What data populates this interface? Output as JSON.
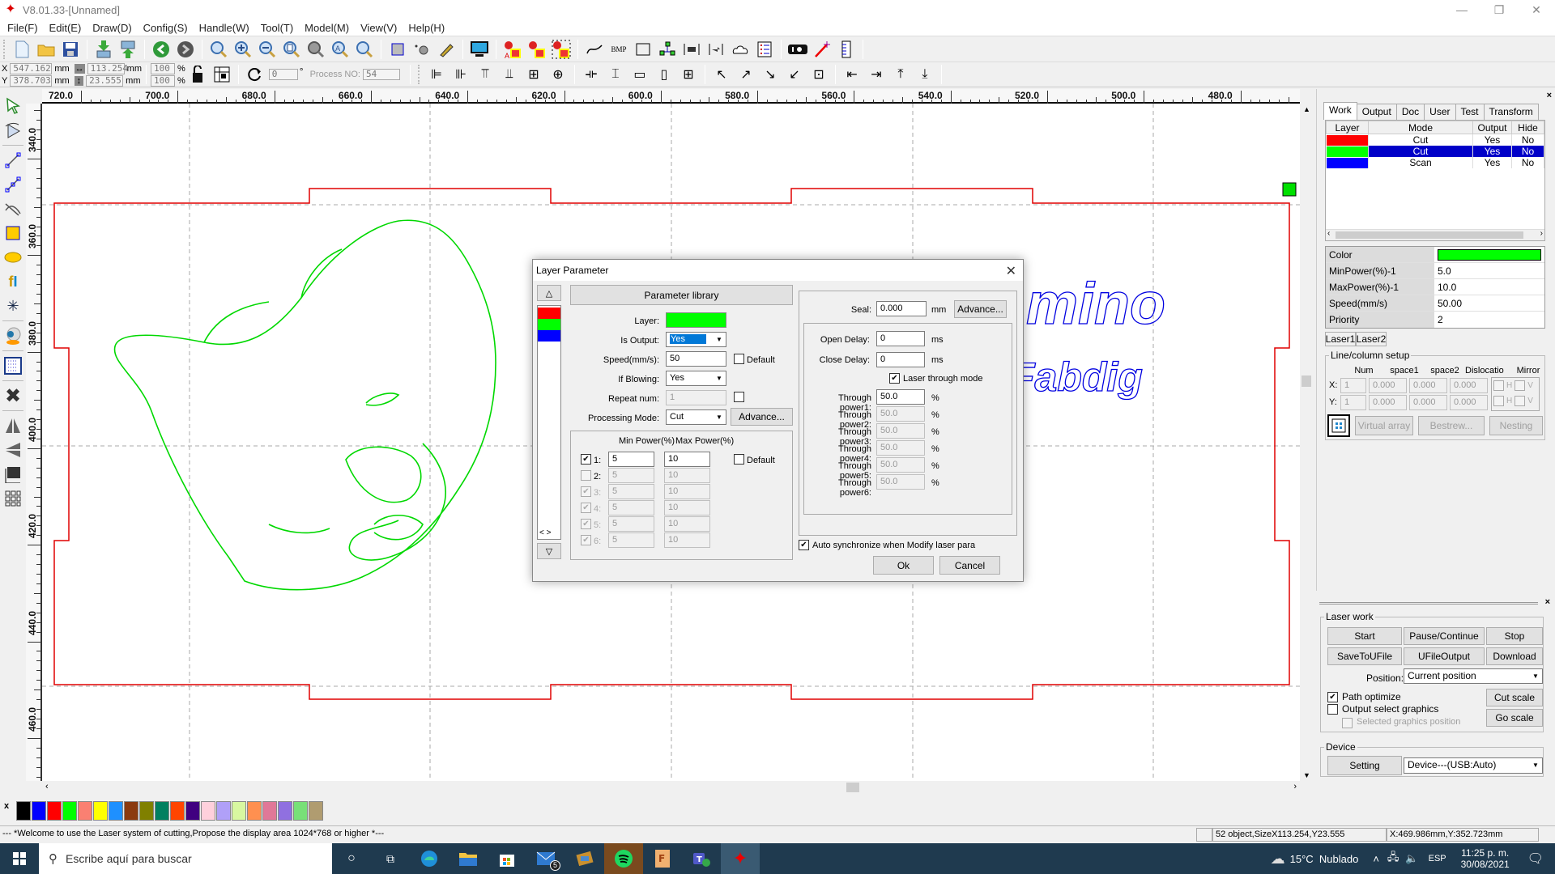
{
  "app": {
    "title": "V8.01.33-[Unnamed]",
    "window_controls": {
      "minimize": "—",
      "maximize": "❐",
      "close": "✕"
    }
  },
  "menu": [
    "File(F)",
    "Edit(E)",
    "Draw(D)",
    "Config(S)",
    "Handle(W)",
    "Tool(T)",
    "Model(M)",
    "View(V)",
    "Help(H)"
  ],
  "toolbar": {
    "x_label": "X",
    "y_label": "Y",
    "x_value": "547.162",
    "y_value": "378.703",
    "width_value": "113.254",
    "height_value": "23.555",
    "unit": "mm",
    "scale_x": "100",
    "scale_y": "100",
    "percent": "%",
    "rotate_value": "0",
    "degree": "°",
    "process_no_label": "Process NO:",
    "process_no_value": "54",
    "bmp_label": "BMP"
  },
  "ruler": {
    "h_labels": [
      "720.0",
      "700.0",
      "680.0",
      "660.0",
      "640.0",
      "620.0",
      "600.0",
      "580.0",
      "560.0",
      "540.0",
      "520.0",
      "500.0",
      "480.0"
    ],
    "v_labels": [
      "340.0",
      "360.0",
      "380.0",
      "400.0",
      "420.0",
      "440.0",
      "460.0"
    ]
  },
  "canvas": {
    "text_1": "mino",
    "text_2": "Fabdig",
    "colors": {
      "cut_red": "#e00000",
      "green": "#00d000",
      "blue": "#0000e0"
    }
  },
  "right_panel": {
    "tabs": [
      "Work",
      "Output",
      "Doc",
      "User",
      "Test",
      "Transform"
    ],
    "active_tab": "Work",
    "layer_table": {
      "headers": [
        "Layer",
        "Mode",
        "Output",
        "Hide"
      ],
      "rows": [
        {
          "color": "#ff0000",
          "mode": "Cut",
          "output": "Yes",
          "hide": "No",
          "selected": false
        },
        {
          "color": "#00ff00",
          "mode": "Cut",
          "output": "Yes",
          "hide": "No",
          "selected": true
        },
        {
          "color": "#0000ff",
          "mode": "Scan",
          "output": "Yes",
          "hide": "No",
          "selected": false
        }
      ]
    },
    "properties": [
      {
        "key": "Color",
        "value": "",
        "swatch": "#00ff00"
      },
      {
        "key": "MinPower(%)-1",
        "value": "5.0"
      },
      {
        "key": "MaxPower(%)-1",
        "value": "10.0"
      },
      {
        "key": "Speed(mm/s)",
        "value": "50.00"
      },
      {
        "key": "Priority",
        "value": "2"
      }
    ],
    "laser_tabs": [
      "Laser1",
      "Laser2"
    ],
    "line_column": {
      "legend": "Line/column setup",
      "headers": [
        "Num",
        "space1",
        "space2",
        "Dislocation",
        "Mirror"
      ],
      "x_label": "X:",
      "y_label": "Y:",
      "x_values": [
        "1",
        "0.000",
        "0.000",
        "0.000"
      ],
      "y_values": [
        "1",
        "0.000",
        "0.000",
        "0.000"
      ],
      "mirror_h": "H",
      "mirror_v": "V",
      "buttons": [
        "Virtual array",
        "Bestrew...",
        "Nesting"
      ]
    },
    "laser_work": {
      "legend": "Laser work",
      "buttons": [
        "Start",
        "Pause/Continue",
        "Stop",
        "SaveToUFile",
        "UFileOutput",
        "Download"
      ],
      "position_label": "Position:",
      "position_value": "Current position",
      "path_optimize": {
        "label": "Path optimize",
        "checked": true
      },
      "output_select": {
        "label": "Output select graphics",
        "checked": false
      },
      "selected_position": {
        "label": "Selected graphics position",
        "checked": false,
        "disabled": true
      },
      "cut_scale": "Cut scale",
      "go_scale": "Go scale"
    },
    "device": {
      "legend": "Device",
      "setting": "Setting",
      "value": "Device---(USB:Auto)"
    }
  },
  "dialog": {
    "title": "Layer Parameter",
    "layer_colors": [
      "#ff0000",
      "#00ff00",
      "#0000ff"
    ],
    "param_library": "Parameter library",
    "layer_label": "Layer:",
    "layer_color": "#00ff00",
    "is_output_label": "Is Output:",
    "is_output_value": "Yes",
    "speed_label": "Speed(mm/s):",
    "speed_value": "50",
    "default_label": "Default",
    "if_blowing_label": "If Blowing:",
    "if_blowing_value": "Yes",
    "repeat_label": "Repeat num:",
    "repeat_value": "1",
    "processing_label": "Processing Mode:",
    "processing_value": "Cut",
    "advance": "Advance...",
    "min_power_header": "Min Power(%)",
    "max_power_header": "Max Power(%)",
    "power_rows": [
      {
        "label": "1:",
        "min": "5",
        "max": "10",
        "checked": true,
        "enabled": true
      },
      {
        "label": "2:",
        "min": "5",
        "max": "10",
        "checked": false,
        "enabled": false
      },
      {
        "label": "3:",
        "min": "5",
        "max": "10",
        "checked": true,
        "enabled": false
      },
      {
        "label": "4:",
        "min": "5",
        "max": "10",
        "checked": true,
        "enabled": false
      },
      {
        "label": "5:",
        "min": "5",
        "max": "10",
        "checked": true,
        "enabled": false
      },
      {
        "label": "6:",
        "min": "5",
        "max": "10",
        "checked": true,
        "enabled": false
      }
    ],
    "seal_label": "Seal:",
    "seal_value": "0.000",
    "mm": "mm",
    "ms": "ms",
    "open_delay_label": "Open Delay:",
    "open_delay_value": "0",
    "close_delay_label": "Close Delay:",
    "close_delay_value": "0",
    "laser_through_label": "Laser through mode",
    "laser_through_checked": true,
    "through_powers": [
      {
        "label": "Through power1:",
        "value": "50.0",
        "enabled": true
      },
      {
        "label": "Through power2:",
        "value": "50.0",
        "enabled": false
      },
      {
        "label": "Through power3:",
        "value": "50.0",
        "enabled": false
      },
      {
        "label": "Through power4:",
        "value": "50.0",
        "enabled": false
      },
      {
        "label": "Through power5:",
        "value": "50.0",
        "enabled": false
      },
      {
        "label": "Through power6:",
        "value": "50.0",
        "enabled": false
      }
    ],
    "percent": "%",
    "auto_sync_label": "Auto synchronize when Modify laser para",
    "auto_sync_checked": true,
    "ok": "Ok",
    "cancel": "Cancel",
    "nav_arrows": "< >"
  },
  "palette": [
    "#000000",
    "#0000ff",
    "#ff0000",
    "#00ff00",
    "#fa8072",
    "#ffff00",
    "#1e90ff",
    "#8b3a0f",
    "#808000",
    "#008060",
    "#ff4500",
    "#400080",
    "#ffd0dc",
    "#b0a0f8",
    "#d8f8a0",
    "#ff9050",
    "#e07898",
    "#9070e0",
    "#78e078",
    "#b09c70"
  ],
  "statusbar": {
    "message": "--- *Welcome to use the Laser system of cutting,Propose the display area 1024*768 or higher *---",
    "objects": "52 object,SizeX113.254,Y23.555",
    "coords": "X:469.986mm,Y:352.723mm"
  },
  "taskbar": {
    "search_placeholder": "Escribe aquí para buscar",
    "mail_badge": "5",
    "weather": "15°C  Nublado",
    "language": "ESP",
    "time": "11:25 p. m.",
    "date": "30/08/2021"
  }
}
